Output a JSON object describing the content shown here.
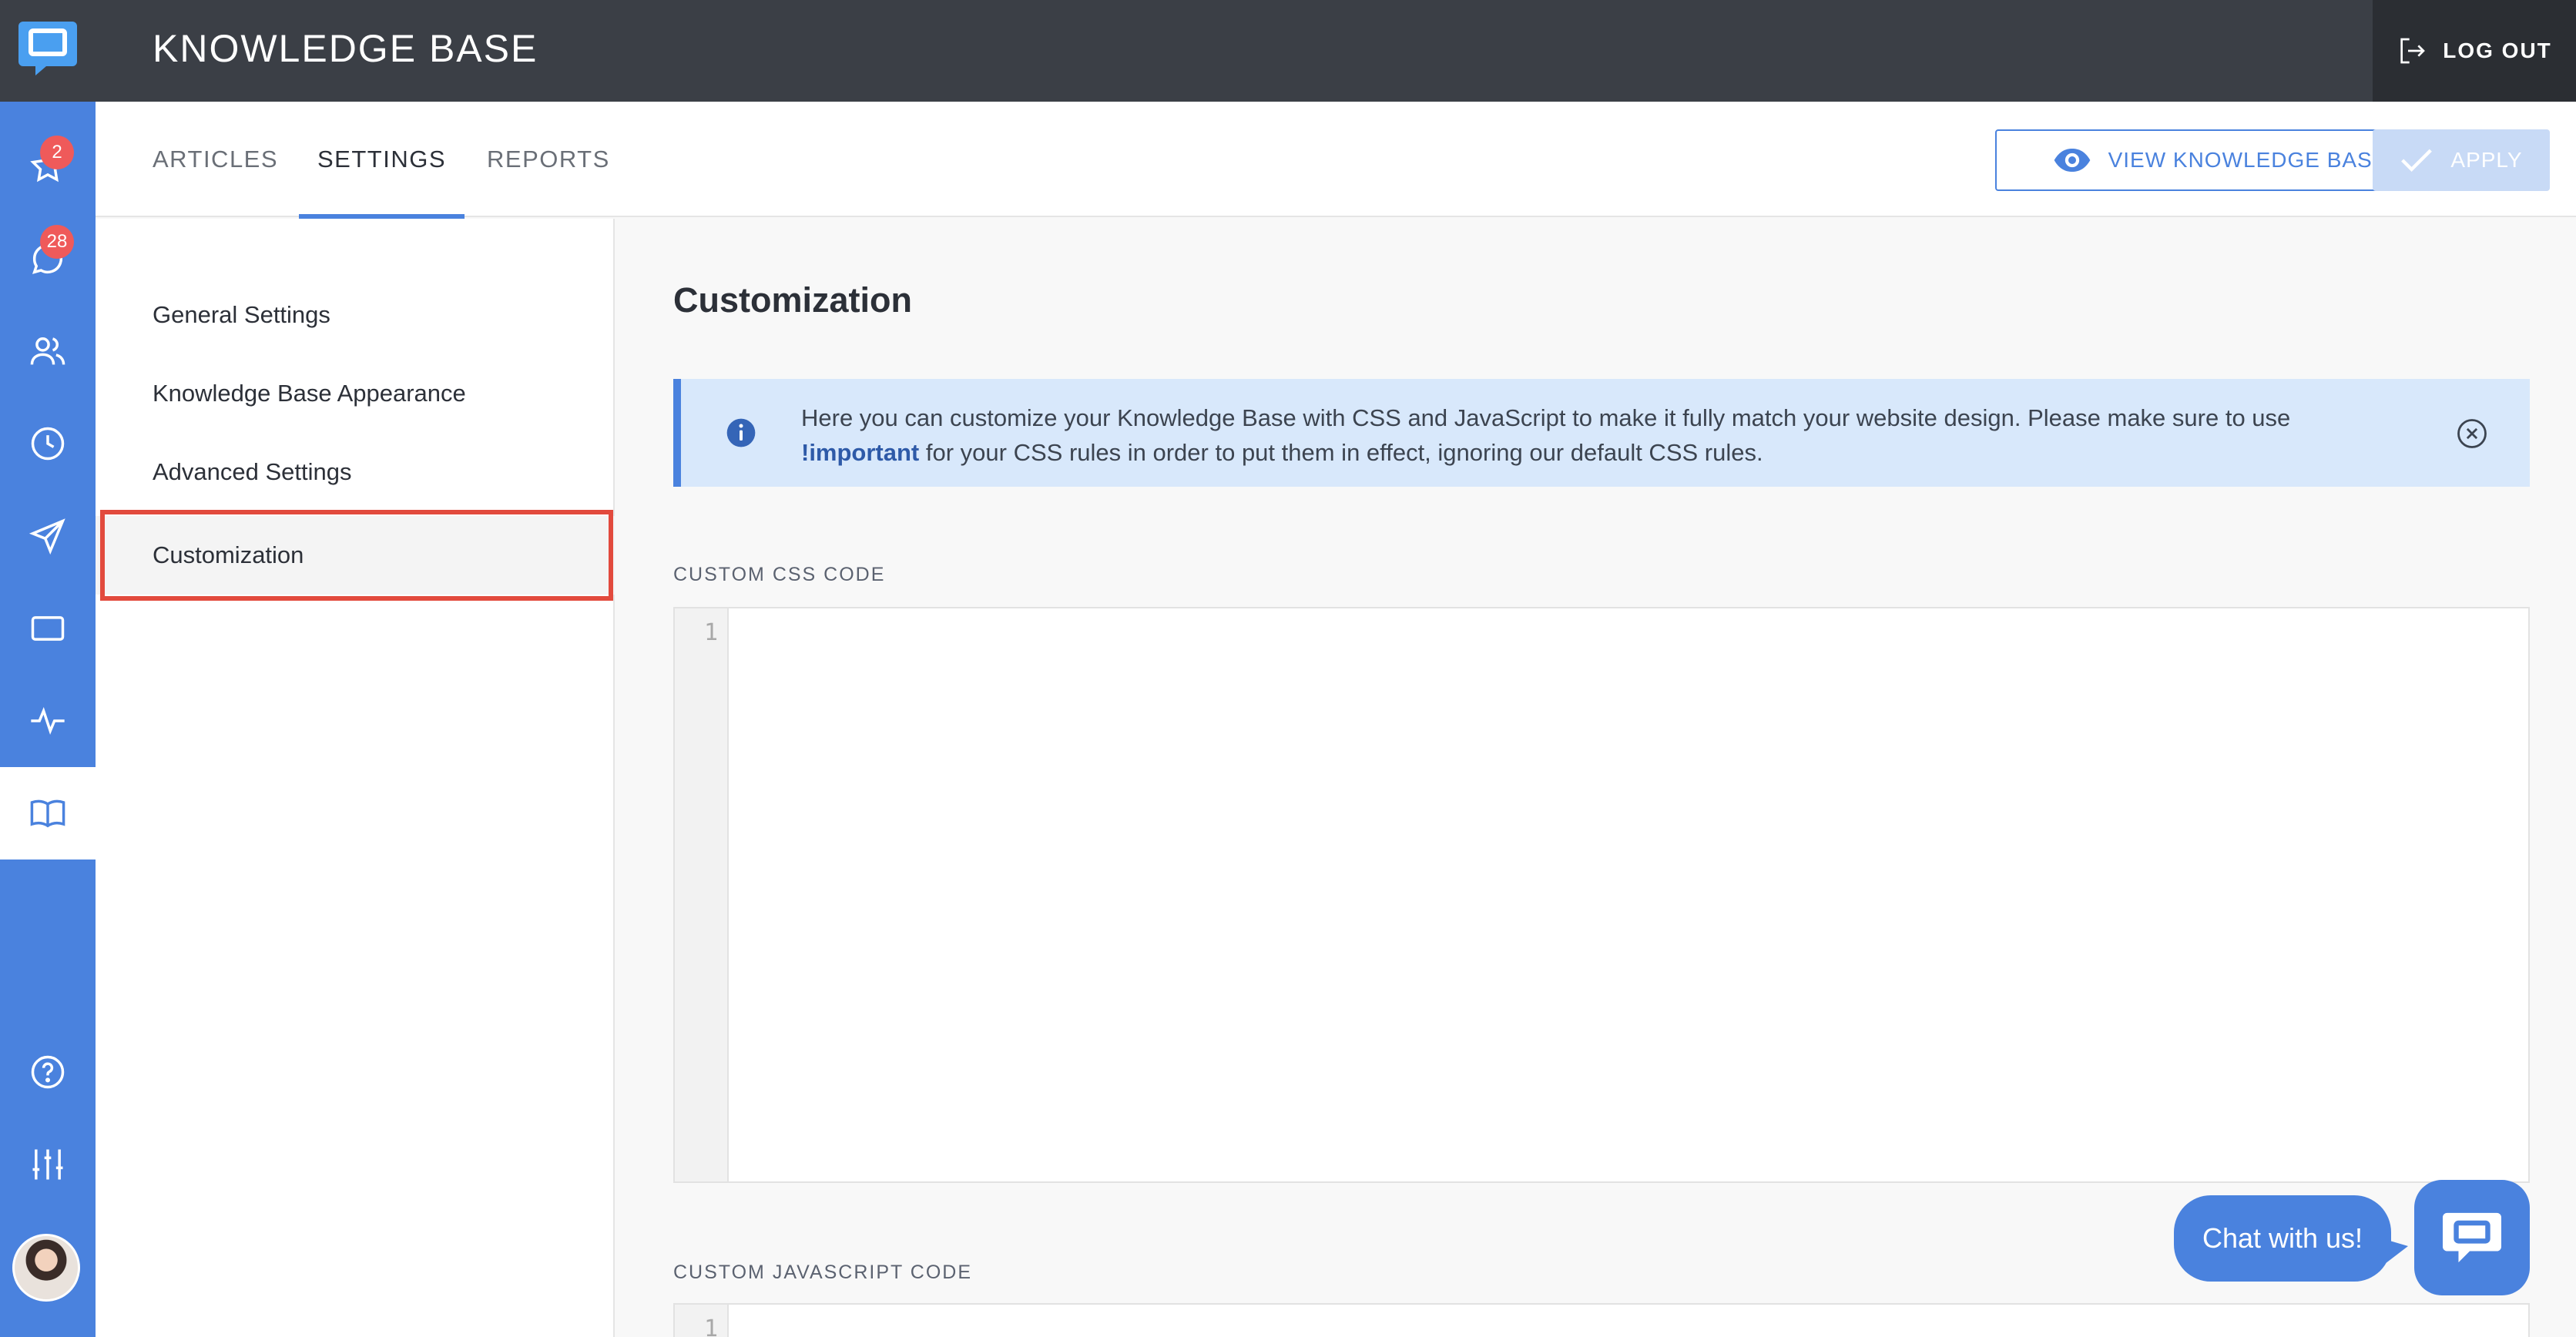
{
  "app": {
    "title": "KNOWLEDGE BASE",
    "logout_label": "LOG OUT"
  },
  "rail": {
    "badges": {
      "starred": "2",
      "chats": "28"
    }
  },
  "tabs": [
    {
      "label": "ARTICLES",
      "active": false
    },
    {
      "label": "SETTINGS",
      "active": true
    },
    {
      "label": "REPORTS",
      "active": false
    }
  ],
  "toolbar": {
    "view_label": "VIEW KNOWLEDGE BASE",
    "apply_label": "APPLY"
  },
  "settings_menu": [
    {
      "label": "General Settings"
    },
    {
      "label": "Knowledge Base Appearance"
    },
    {
      "label": "Advanced Settings"
    },
    {
      "label": "Customization",
      "active": true
    }
  ],
  "main": {
    "title": "Customization",
    "info": {
      "text_before": "Here you can customize your Knowledge Base with CSS and JavaScript to make it fully match your website design. Please make sure to use",
      "highlight": "!important",
      "text_after": "for your CSS rules in order to put them in effect, ignoring our default CSS rules."
    },
    "css_label": "CUSTOM CSS CODE",
    "css_line": "1",
    "js_label": "CUSTOM JAVASCRIPT CODE",
    "js_line": "1"
  },
  "chat": {
    "bubble": "Chat with us!"
  },
  "colors": {
    "accent": "#4a82de",
    "header": "#3b3f46",
    "highlight_border": "#e24a3d",
    "badge": "#ef5a5a"
  }
}
